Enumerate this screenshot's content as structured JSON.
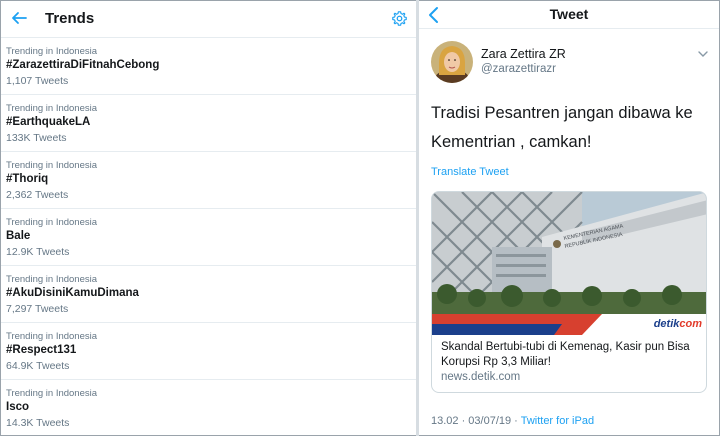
{
  "left_panel": {
    "title": "Trends",
    "trends": [
      {
        "context": "Trending in Indonesia",
        "name": "#ZarazettiraDiFitnahCebong",
        "count": "1,107 Tweets"
      },
      {
        "context": "Trending in Indonesia",
        "name": "#EarthquakeLA",
        "count": "133K Tweets"
      },
      {
        "context": "Trending in Indonesia",
        "name": "#Thoriq",
        "count": "2,362 Tweets"
      },
      {
        "context": "Trending in Indonesia",
        "name": "Bale",
        "count": "12.9K Tweets"
      },
      {
        "context": "Trending in Indonesia",
        "name": "#AkuDisiniKamuDimana",
        "count": "7,297 Tweets"
      },
      {
        "context": "Trending in Indonesia",
        "name": "#Respect131",
        "count": "64.9K Tweets"
      },
      {
        "context": "Trending in Indonesia",
        "name": "Isco",
        "count": "14.3K Tweets"
      }
    ]
  },
  "right_panel": {
    "title": "Tweet",
    "author": {
      "display_name": "Zara Zettira ZR",
      "handle": "@zarazettirazr"
    },
    "text": "Tradisi Pesantren jangan dibawa ke Kementrian , camkan!",
    "translate_label": "Translate Tweet",
    "card": {
      "logo_main": "detik",
      "logo_suffix": "com",
      "building_sign_line1": "KEMENTERIAN AGAMA",
      "building_sign_line2": "REPUBLIK INDONESIA",
      "title": "Skandal Bertubi-tubi di Kemenag, Kasir pun Bisa Korupsi Rp 3,3 Miliar!",
      "domain": "news.detik.com"
    },
    "meta": {
      "timestamp": "13.02 · 03/07/19 ·",
      "source": "Twitter for iPad"
    }
  },
  "colors": {
    "accent": "#1da1f2",
    "text": "#14171a",
    "secondary": "#657786",
    "border": "#e6ecf0"
  }
}
